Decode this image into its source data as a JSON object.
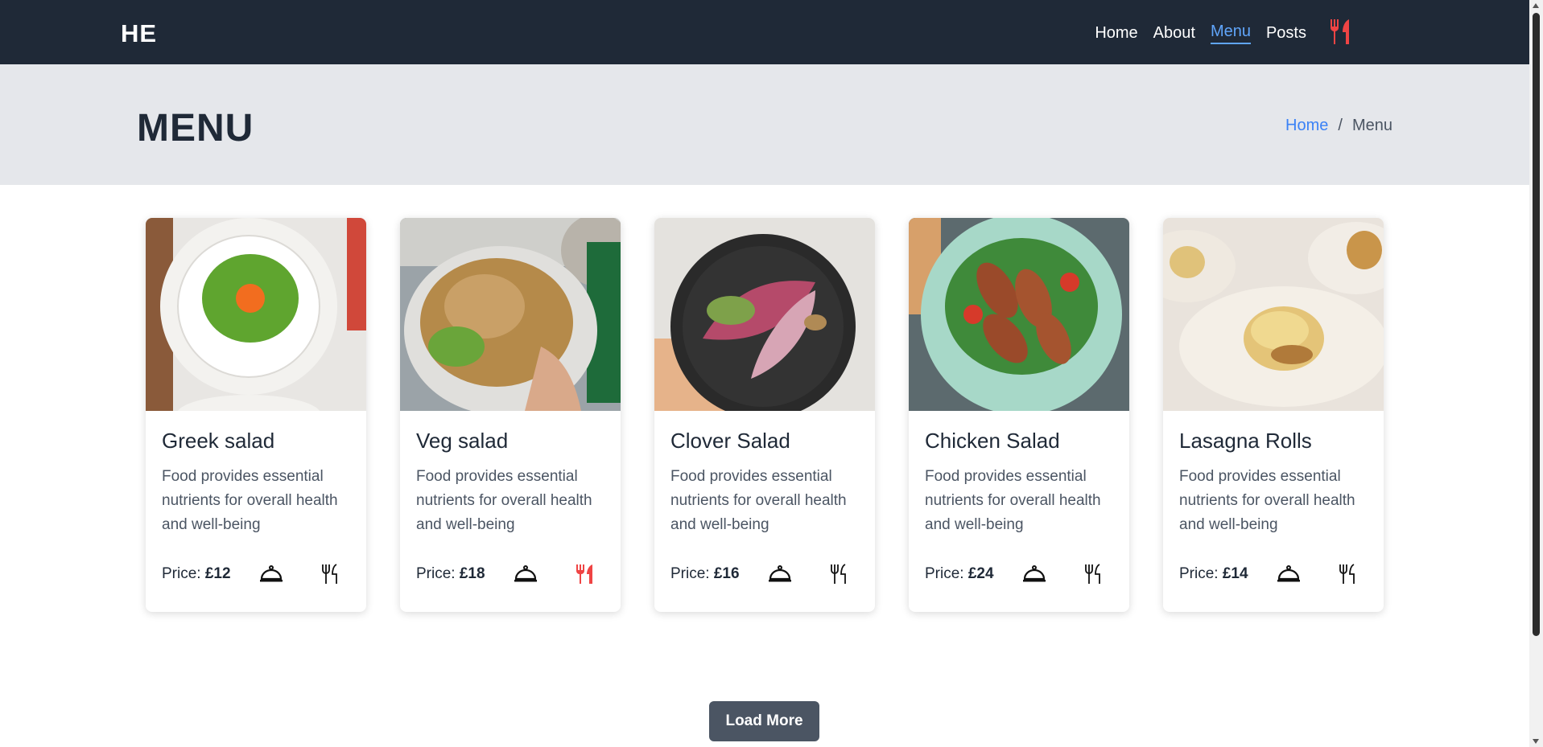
{
  "brand": "HE",
  "nav": {
    "items": [
      {
        "label": "Home"
      },
      {
        "label": "About"
      },
      {
        "label": "Menu",
        "active": true
      },
      {
        "label": "Posts"
      }
    ],
    "icon": "fork-knife-icon"
  },
  "page_title": "MENU",
  "breadcrumb": {
    "home": "Home",
    "separator": "/",
    "current": "Menu"
  },
  "cards": [
    {
      "title": "Greek salad",
      "description": "Food provides essential nutrients for overall health and well-being",
      "price_label": "Price:",
      "price": "£12",
      "utensil_highlight": false
    },
    {
      "title": "Veg salad",
      "description": "Food provides essential nutrients for overall health and well-being",
      "price_label": "Price:",
      "price": "£18",
      "utensil_highlight": true
    },
    {
      "title": "Clover Salad",
      "description": "Food provides essential nutrients for overall health and well-being",
      "price_label": "Price:",
      "price": "£16",
      "utensil_highlight": false
    },
    {
      "title": "Chicken Salad",
      "description": "Food provides essential nutrients for overall health and well-being",
      "price_label": "Price:",
      "price": "£24",
      "utensil_highlight": false
    },
    {
      "title": "Lasagna Rolls",
      "description": "Food provides essential nutrients for overall health and well-being",
      "price_label": "Price:",
      "price": "£14",
      "utensil_highlight": false
    }
  ],
  "load_more": "Load More",
  "colors": {
    "navbar": "#1f2937",
    "accent_blue": "#60a5fa",
    "accent_red": "#ef4444",
    "hero_bg": "#e5e7eb",
    "button": "#4b5563"
  }
}
